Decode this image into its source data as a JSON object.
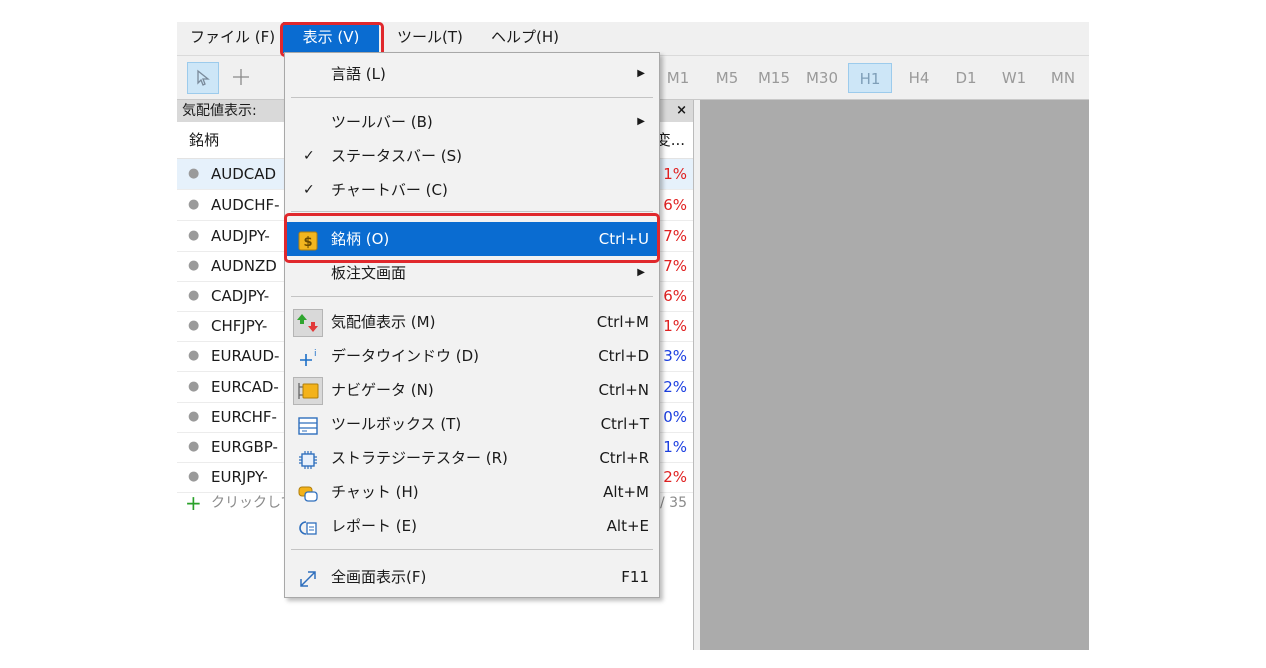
{
  "menubar": {
    "items": [
      {
        "label": "ファイル (F)"
      },
      {
        "label": "表示 (V)"
      },
      {
        "label": "ツール(T)"
      },
      {
        "label": "ヘルプ(H)"
      }
    ]
  },
  "toolbar": {
    "timeframes": [
      "M1",
      "M5",
      "M15",
      "M30",
      "H1",
      "H4",
      "D1",
      "W1",
      "MN"
    ],
    "selected_timeframe": "H1"
  },
  "market_watch": {
    "title": "気配値表示:",
    "close": "×",
    "col_symbol": "銘柄",
    "col_change": "変...",
    "rows": [
      {
        "symbol": "AUDCAD",
        "change": "1%",
        "color": "red"
      },
      {
        "symbol": "AUDCHF-",
        "change": "6%",
        "color": "red"
      },
      {
        "symbol": "AUDJPY-",
        "change": "7%",
        "color": "red"
      },
      {
        "symbol": "AUDNZD",
        "change": "7%",
        "color": "red"
      },
      {
        "symbol": "CADJPY-",
        "change": "6%",
        "color": "red"
      },
      {
        "symbol": "CHFJPY-",
        "change": "1%",
        "color": "red"
      },
      {
        "symbol": "EURAUD-",
        "change": "3%",
        "color": "blue"
      },
      {
        "symbol": "EURCAD-",
        "change": "2%",
        "color": "blue"
      },
      {
        "symbol": "EURCHF-",
        "change": "0%",
        "color": "blue"
      },
      {
        "symbol": "EURGBP-",
        "change": "1%",
        "color": "blue"
      },
      {
        "symbol": "EURJPY-",
        "change": "2%",
        "color": "red"
      }
    ],
    "add_label": "クリックして",
    "count": "/ 35"
  },
  "view_menu": {
    "language": {
      "label": "言語 (L)"
    },
    "toolbar": {
      "label": "ツールバー (B)"
    },
    "status_bar": {
      "label": "ステータスバー (S)"
    },
    "chart_bar": {
      "label": "チャートバー (C)"
    },
    "symbols": {
      "label": "銘柄 (O)",
      "shortcut": "Ctrl+U"
    },
    "depth": {
      "label": "板注文画面"
    },
    "market_watch": {
      "label": "気配値表示 (M)",
      "shortcut": "Ctrl+M"
    },
    "data_window": {
      "label": "データウインドウ (D)",
      "shortcut": "Ctrl+D"
    },
    "navigator": {
      "label": "ナビゲータ (N)",
      "shortcut": "Ctrl+N"
    },
    "toolbox": {
      "label": "ツールボックス (T)",
      "shortcut": "Ctrl+T"
    },
    "strategy_tester": {
      "label": "ストラテジーテスター (R)",
      "shortcut": "Ctrl+R"
    },
    "chat": {
      "label": "チャット (H)",
      "shortcut": "Alt+M"
    },
    "report": {
      "label": "レポート (E)",
      "shortcut": "Alt+E"
    },
    "fullscreen": {
      "label": "全画面表示(F)",
      "shortcut": "F11"
    },
    "check_mark": "✓",
    "submenu_arrow": "▶"
  },
  "colors": {
    "highlight": "#0a6cd1",
    "annotation_red": "#e0282c",
    "negative": "#e02020",
    "positive": "#1b3ee0"
  }
}
